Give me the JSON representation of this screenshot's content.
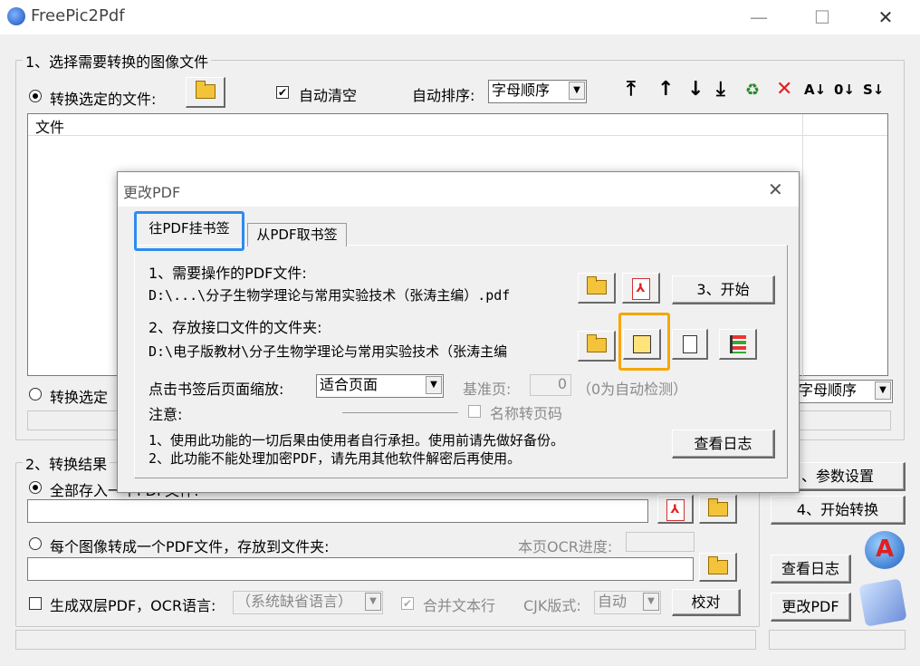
{
  "window": {
    "title": "FreePic2Pdf",
    "minimize": "—",
    "maximize": "☐",
    "close": "✕"
  },
  "section1": {
    "legend": "1、选择需要转换的图像文件",
    "radio_selected_files": "转换选定的文件:",
    "auto_clear": "自动清空",
    "auto_sort_label": "自动排序:",
    "auto_sort_value": "字母顺序",
    "file_column": "文件",
    "radio_selected_folder": "转换选定",
    "folder_sort_value": "字母顺序"
  },
  "section2": {
    "legend": "2、转换结果",
    "radio_all_in_one": "全部存入一个PDF文件:",
    "radio_each_image": "每个图像转成一个PDF文件，存放到文件夹:",
    "ocr_progress_label": "本页OCR进度:",
    "dual_layer_label": "生成双层PDF，OCR语言:",
    "ocr_lang_value": "（系统缺省语言）",
    "merge_lines": "合并文本行",
    "cjk_label": "CJK版式:",
    "cjk_value": "自动",
    "proofread": "校对"
  },
  "right_buttons": {
    "params": "、参数设置",
    "start_convert": "4、开始转换",
    "view_log": "查看日志",
    "change_pdf": "更改PDF"
  },
  "dialog": {
    "title": "更改PDF",
    "close": "✕",
    "tab_active": "往PDF挂书签",
    "tab_other": "从PDF取书签",
    "step1_label": "1、需要操作的PDF文件:",
    "step1_value": "D:\\...\\分子生物学理论与常用实验技术（张涛主编）.pdf",
    "start_button": "3、开始",
    "step2_label": "2、存放接口文件的文件夹:",
    "step2_value": "D:\\电子版教材\\分子生物学理论与常用实验技术（张涛主编",
    "zoom_label": "点击书签后页面缩放:",
    "zoom_value": "适合页面",
    "base_page_label": "基准页:",
    "base_page_value": "0",
    "base_page_hint": "（0为自动检测）",
    "name_to_page": "名称转页码",
    "notice_label": "注意:",
    "notice_1": "1、使用此功能的一切后果由使用者自行承担。使用前请先做好备份。",
    "notice_2": "2、此功能不能处理加密PDF，请先用其他软件解密后再使用。",
    "view_log": "查看日志"
  },
  "colors": {
    "highlight_blue": "#2d8bf0",
    "highlight_orange": "#f5a700"
  }
}
